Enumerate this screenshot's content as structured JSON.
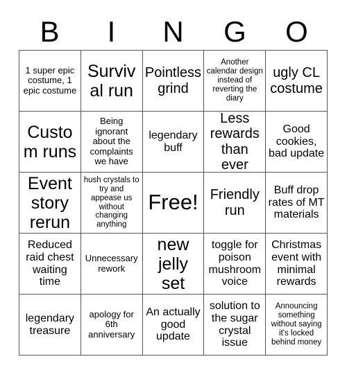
{
  "card": {
    "title": "BINGO",
    "header_letters": [
      "B",
      "I",
      "N",
      "G",
      "O"
    ],
    "grid_size": 5,
    "colors": {
      "background": "#ffffff",
      "text": "#000000",
      "grid_line": "#555555"
    },
    "free_space": {
      "label": "Free!",
      "row": 3,
      "column": 3
    },
    "rows": [
      [
        {
          "text": "1 super epic costume, 1 epic costume",
          "size": "sm"
        },
        {
          "text": "Survival run",
          "size": "xl"
        },
        {
          "text": "Pointless grind",
          "size": "lg"
        },
        {
          "text": "Another calendar design instead of reverting the diary",
          "size": "xs"
        },
        {
          "text": "ugly CL costume",
          "size": "lg"
        }
      ],
      [
        {
          "text": "Custom runs",
          "size": "xl"
        },
        {
          "text": "Being ignorant about the complaints we have",
          "size": "sm"
        },
        {
          "text": "legendary buff",
          "size": "md"
        },
        {
          "text": "Less rewards than ever",
          "size": "lg"
        },
        {
          "text": "Good cookies, bad update",
          "size": "md"
        }
      ],
      [
        {
          "text": "Event story rerun",
          "size": "xl"
        },
        {
          "text": "hush crystals to try and appease us without changing anything",
          "size": "xs"
        },
        {
          "text": "Free!",
          "size": "free"
        },
        {
          "text": "Friendly run",
          "size": "lg"
        },
        {
          "text": "Buff drop rates of MT materials",
          "size": "md"
        }
      ],
      [
        {
          "text": "Reduced raid chest waiting time",
          "size": "md"
        },
        {
          "text": "Unnecessary rework",
          "size": "sm"
        },
        {
          "text": "new jelly set",
          "size": "xl"
        },
        {
          "text": "toggle for poison mushroom voice",
          "size": "md"
        },
        {
          "text": "Christmas event with minimal rewards",
          "size": "md"
        }
      ],
      [
        {
          "text": "legendary treasure",
          "size": "md"
        },
        {
          "text": "apology for 6th anniversary",
          "size": "sm"
        },
        {
          "text": "An actually good update",
          "size": "md"
        },
        {
          "text": "solution to the sugar crystal issue",
          "size": "md"
        },
        {
          "text": "Announcing something without saying it's locked behind money",
          "size": "xs"
        }
      ]
    ]
  }
}
